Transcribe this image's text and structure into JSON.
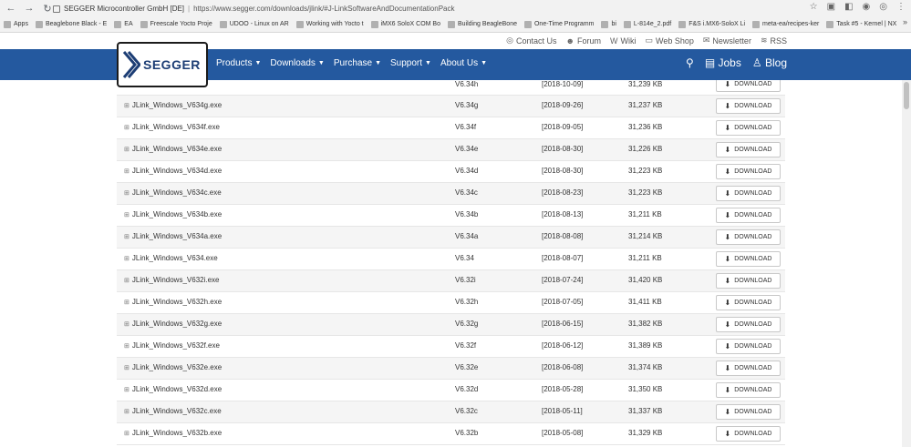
{
  "browser": {
    "tab_title": "SEGGER Microcontroller GmbH [DE]",
    "url": "https://www.segger.com/downloads/jlink/#J-LinkSoftwareAndDocumentationPack",
    "bookmarks": [
      "Apps",
      "Beaglebone Black - E",
      "EA",
      "Freescale Yocto Proje",
      "UDOO - Linux on AR",
      "Working with Yocto t",
      "iMX6 SoloX COM Bo",
      "Building BeagleBone",
      "One-Time Programm",
      "bi",
      "L-814e_2.pdf",
      "F&S i.MX6-SoloX Li",
      "meta-ea/recipes-ker",
      "Task #5 - Kernel | NX"
    ],
    "more": "»"
  },
  "utility_links": [
    {
      "icon": "help-icon",
      "label": "Contact Us"
    },
    {
      "icon": "forum-icon",
      "label": "Forum"
    },
    {
      "icon": "wiki-icon",
      "label": "Wiki"
    },
    {
      "icon": "cart-icon",
      "label": "Web Shop"
    },
    {
      "icon": "mail-icon",
      "label": "Newsletter"
    },
    {
      "icon": "rss-icon",
      "label": "RSS"
    }
  ],
  "logo_text": "SEGGER",
  "menu": [
    "Products",
    "Downloads",
    "Purchase",
    "Support",
    "About Us"
  ],
  "nav_right": {
    "jobs": "Jobs",
    "blog": "Blog"
  },
  "button_label": "DOWNLOAD",
  "rows": [
    {
      "file": "",
      "version": "V6.34h",
      "date": "[2018-10-09]",
      "size": "31,239 KB"
    },
    {
      "file": "JLink_Windows_V634g.exe",
      "version": "V6.34g",
      "date": "[2018-09-26]",
      "size": "31,237 KB"
    },
    {
      "file": "JLink_Windows_V634f.exe",
      "version": "V6.34f",
      "date": "[2018-09-05]",
      "size": "31,236 KB"
    },
    {
      "file": "JLink_Windows_V634e.exe",
      "version": "V6.34e",
      "date": "[2018-08-30]",
      "size": "31,226 KB"
    },
    {
      "file": "JLink_Windows_V634d.exe",
      "version": "V6.34d",
      "date": "[2018-08-30]",
      "size": "31,223 KB"
    },
    {
      "file": "JLink_Windows_V634c.exe",
      "version": "V6.34c",
      "date": "[2018-08-23]",
      "size": "31,223 KB"
    },
    {
      "file": "JLink_Windows_V634b.exe",
      "version": "V6.34b",
      "date": "[2018-08-13]",
      "size": "31,211 KB"
    },
    {
      "file": "JLink_Windows_V634a.exe",
      "version": "V6.34a",
      "date": "[2018-08-08]",
      "size": "31,214 KB"
    },
    {
      "file": "JLink_Windows_V634.exe",
      "version": "V6.34",
      "date": "[2018-08-07]",
      "size": "31,211 KB"
    },
    {
      "file": "JLink_Windows_V632i.exe",
      "version": "V6.32i",
      "date": "[2018-07-24]",
      "size": "31,420 KB"
    },
    {
      "file": "JLink_Windows_V632h.exe",
      "version": "V6.32h",
      "date": "[2018-07-05]",
      "size": "31,411 KB"
    },
    {
      "file": "JLink_Windows_V632g.exe",
      "version": "V6.32g",
      "date": "[2018-06-15]",
      "size": "31,382 KB"
    },
    {
      "file": "JLink_Windows_V632f.exe",
      "version": "V6.32f",
      "date": "[2018-06-12]",
      "size": "31,389 KB"
    },
    {
      "file": "JLink_Windows_V632e.exe",
      "version": "V6.32e",
      "date": "[2018-06-08]",
      "size": "31,374 KB"
    },
    {
      "file": "JLink_Windows_V632d.exe",
      "version": "V6.32d",
      "date": "[2018-05-28]",
      "size": "31,350 KB"
    },
    {
      "file": "JLink_Windows_V632c.exe",
      "version": "V6.32c",
      "date": "[2018-05-11]",
      "size": "31,337 KB"
    },
    {
      "file": "JLink_Windows_V632b.exe",
      "version": "V6.32b",
      "date": "[2018-05-08]",
      "size": "31,329 KB"
    }
  ],
  "colors": {
    "nav_bg": "#24599f",
    "logo_blue": "#1d3e75"
  }
}
